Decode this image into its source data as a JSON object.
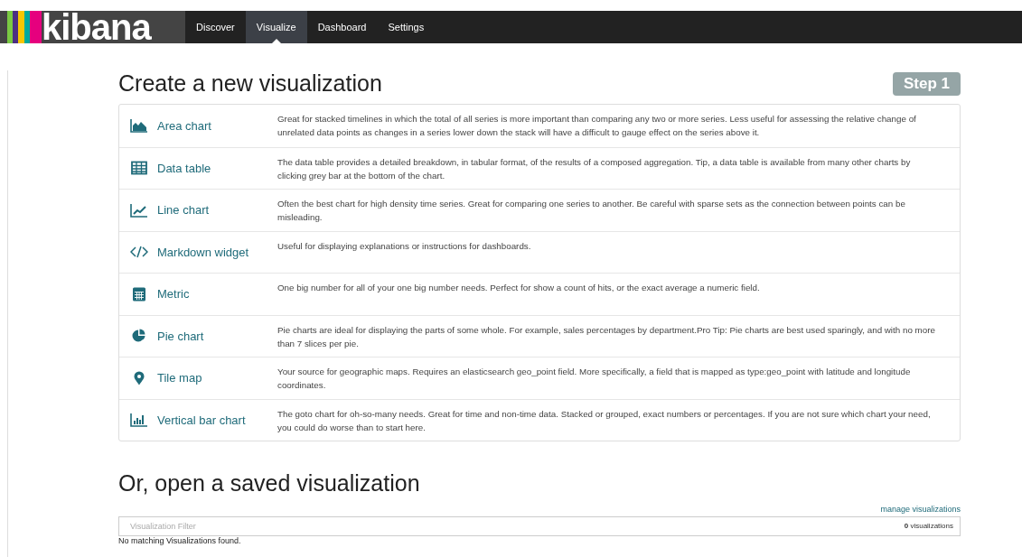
{
  "logo": {
    "text": "kibana"
  },
  "nav": [
    {
      "label": "Discover",
      "selected": false
    },
    {
      "label": "Visualize",
      "selected": true
    },
    {
      "label": "Dashboard",
      "selected": false
    },
    {
      "label": "Settings",
      "selected": false
    }
  ],
  "create": {
    "title": "Create a new visualization",
    "step": "Step 1",
    "types": [
      {
        "kind": "area",
        "name": "Area chart",
        "description": "Great for stacked timelines in which the total of all series is more important than comparing any two or more series. Less useful for assessing the relative change of unrelated data points as changes in a series lower down the stack will have a difficult to gauge effect on the series above it."
      },
      {
        "kind": "table",
        "name": "Data table",
        "description": "The data table provides a detailed breakdown, in tabular format, of the results of a composed aggregation. Tip, a data table is available from many other charts by clicking grey bar at the bottom of the chart."
      },
      {
        "kind": "line",
        "name": "Line chart",
        "description": "Often the best chart for high density time series. Great for comparing one series to another. Be careful with sparse sets as the connection between points can be misleading."
      },
      {
        "kind": "markdown",
        "name": "Markdown widget",
        "description": "Useful for displaying explanations or instructions for dashboards."
      },
      {
        "kind": "metric",
        "name": "Metric",
        "description": "One big number for all of your one big number needs. Perfect for show a count of hits, or the exact average a numeric field."
      },
      {
        "kind": "pie",
        "name": "Pie chart",
        "description": "Pie charts are ideal for displaying the parts of some whole. For example, sales percentages by department.Pro Tip: Pie charts are best used sparingly, and with no more than 7 slices per pie."
      },
      {
        "kind": "map",
        "name": "Tile map",
        "description": "Your source for geographic maps. Requires an elasticsearch geo_point field. More specifically, a field that is mapped as type:geo_point with latitude and longitude coordinates."
      },
      {
        "kind": "bar",
        "name": "Vertical bar chart",
        "description": "The goto chart for oh-so-many needs. Great for time and non-time data. Stacked or grouped, exact numbers or percentages. If you are not sure which chart your need, you could do worse than to start here."
      }
    ]
  },
  "saved": {
    "title": "Or, open a saved visualization",
    "manage_link": "manage visualizations",
    "filter": {
      "placeholder": "Visualization Filter"
    },
    "count": "0",
    "count_label": "visualizations",
    "empty_message": "No matching Visualizations found."
  }
}
